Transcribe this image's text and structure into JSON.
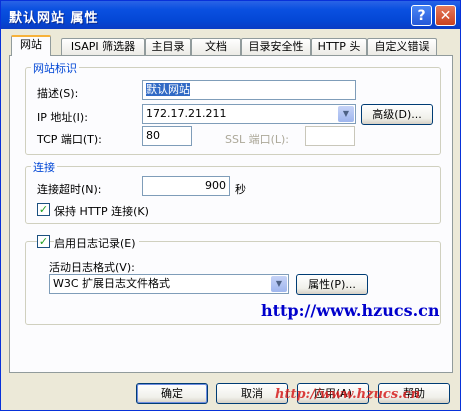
{
  "window": {
    "title": "默认网站 属性",
    "help_glyph": "?",
    "close_glyph": "✕"
  },
  "tabs": [
    {
      "label": "网站",
      "active": true
    },
    {
      "label": "ISAPI 筛选器"
    },
    {
      "label": "主目录"
    },
    {
      "label": "文档"
    },
    {
      "label": "目录安全性"
    },
    {
      "label": "HTTP 头"
    },
    {
      "label": "自定义错误"
    }
  ],
  "site_identity": {
    "group_label": "网站标识",
    "description_label": "描述(S):",
    "description_value": "默认网站",
    "ip_label": "IP 地址(I):",
    "ip_value": "172.17.21.211",
    "advanced_button": "高级(D)...",
    "tcp_label": "TCP 端口(T):",
    "tcp_value": "80",
    "ssl_label": "SSL 端口(L):",
    "ssl_value": ""
  },
  "connection": {
    "group_label": "连接",
    "timeout_label": "连接超时(N):",
    "timeout_value": "900",
    "timeout_unit": "秒",
    "keepalive_label": "保持 HTTP 连接(K)",
    "keepalive_checked": true
  },
  "logging": {
    "enable_label": "启用日志记录(E)",
    "enable_checked": true,
    "format_label": "活动日志格式(V):",
    "format_value": "W3C 扩展日志文件格式",
    "properties_button": "属性(P)..."
  },
  "watermark_url": "http://www.hzucs.cn",
  "watermark_overlay": "http://www.hzucs.cn",
  "buttons": {
    "ok": "确定",
    "cancel": "取消",
    "apply": "应用(A)",
    "help": "帮助"
  },
  "colors": {
    "titlebar": "#0a50e0",
    "group_label": "#0046d5",
    "url": "#0000cc",
    "watermark": "#d61e1e"
  }
}
